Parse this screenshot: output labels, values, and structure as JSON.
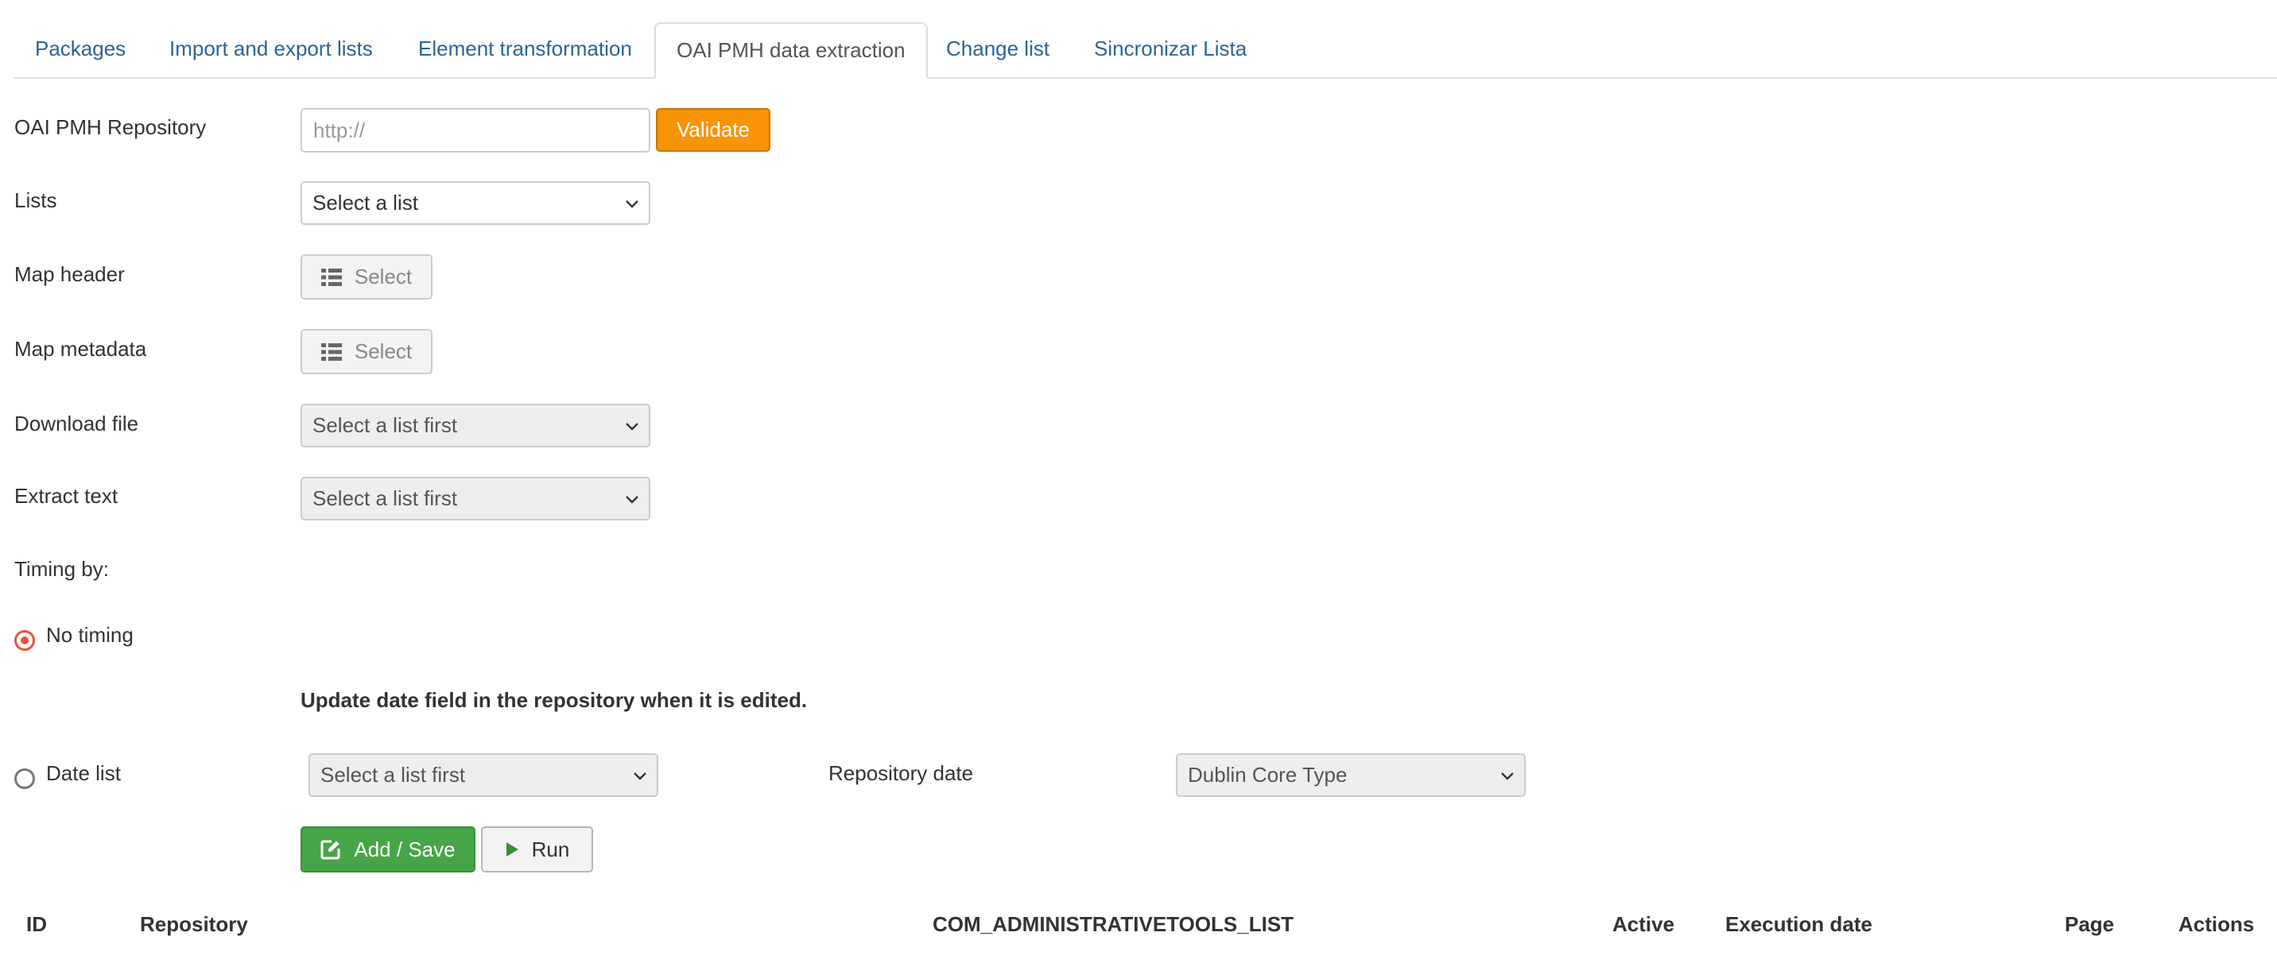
{
  "tabs": [
    {
      "label": "Packages",
      "active": false
    },
    {
      "label": "Import and export lists",
      "active": false
    },
    {
      "label": "Element transformation",
      "active": false
    },
    {
      "label": "OAI PMH data extraction",
      "active": true
    },
    {
      "label": "Change list",
      "active": false
    },
    {
      "label": "Sincronizar Lista",
      "active": false
    }
  ],
  "form": {
    "repository": {
      "label": "OAI PMH Repository",
      "placeholder": "http://",
      "value": "",
      "validate_label": "Validate"
    },
    "lists": {
      "label": "Lists",
      "value": "Select a list"
    },
    "map_header": {
      "label": "Map header",
      "button_label": "Select"
    },
    "map_metadata": {
      "label": "Map metadata",
      "button_label": "Select"
    },
    "download_file": {
      "label": "Download file",
      "value": "Select a list first"
    },
    "extract_text": {
      "label": "Extract text",
      "value": "Select a list first"
    },
    "timing_label": "Timing by:",
    "no_timing": {
      "label": "No timing",
      "checked": true
    },
    "update_note": "Update date field in the repository when it is edited.",
    "date_list": {
      "label": "Date list",
      "checked": false,
      "value": "Select a list first"
    },
    "repository_date": {
      "label": "Repository date",
      "value": "Dublin Core Type"
    },
    "add_save_label": "Add / Save",
    "run_label": "Run"
  },
  "table": {
    "headers": [
      "ID",
      "Repository",
      "COM_ADMINISTRATIVETOOLS_LIST",
      "Active",
      "Execution date",
      "Page",
      "Actions"
    ]
  },
  "colors": {
    "accent_link": "#2a6496",
    "validate": "#f89406",
    "add_save": "#46a546",
    "radio_active": "#e8543e"
  }
}
